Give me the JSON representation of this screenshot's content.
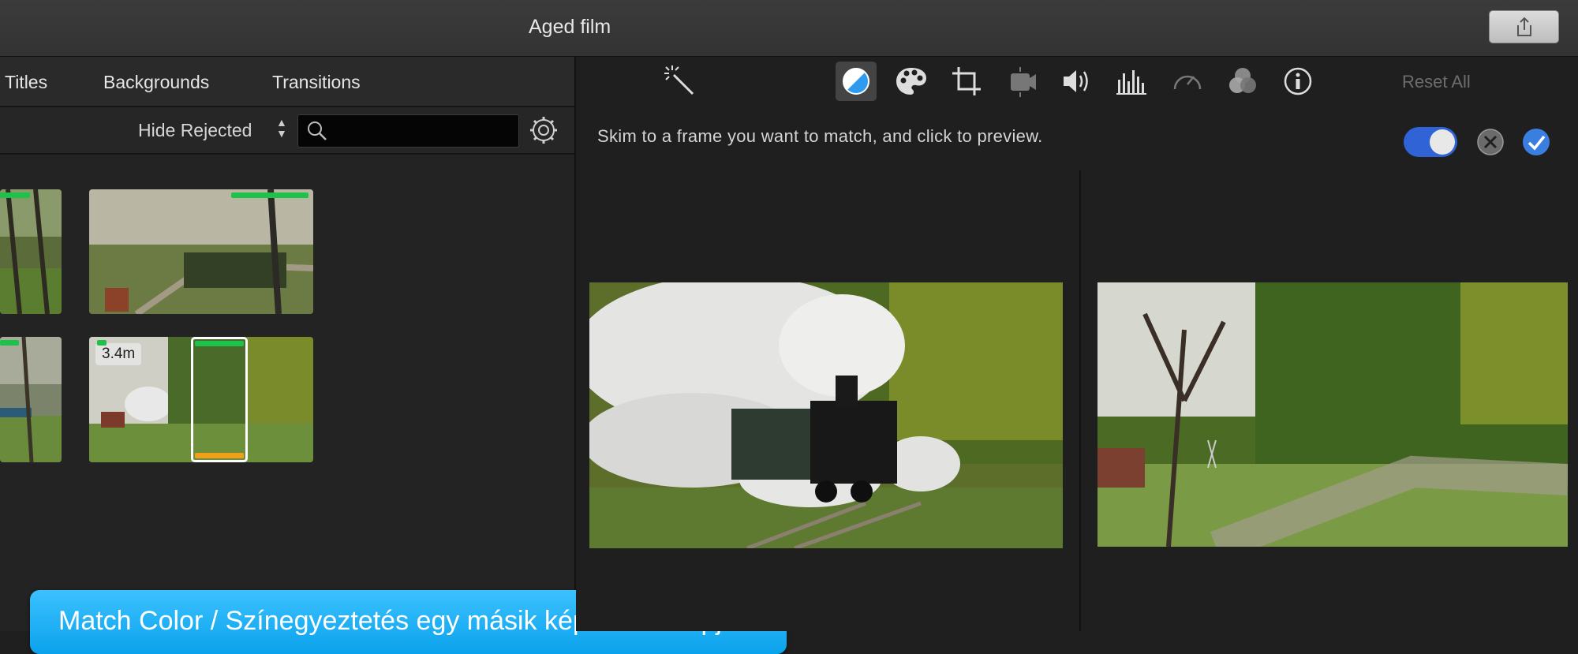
{
  "window": {
    "title": "Aged film"
  },
  "browser": {
    "tabs": [
      {
        "label": "Titles"
      },
      {
        "label": "Backgrounds"
      },
      {
        "label": "Transitions"
      }
    ],
    "filter_label": "Hide Rejected",
    "search": {
      "value": "",
      "placeholder": ""
    },
    "clips": [
      {
        "badge": ""
      },
      {
        "badge": ""
      },
      {
        "badge": ""
      },
      {
        "badge": "3.4m"
      }
    ]
  },
  "adjust": {
    "tool_icons": [
      "magic-wand-icon",
      "color-balance-icon",
      "color-palette-icon",
      "crop-icon",
      "stabilization-camera-icon",
      "volume-icon",
      "equalizer-icon",
      "speed-icon",
      "clip-filter-icon",
      "info-icon"
    ],
    "reset_label": "Reset All",
    "hint": "Skim to a frame you want to match, and click to preview.",
    "toggle_on": true,
    "accent_color": "#2f63d6",
    "confirm_color": "#3a7fe0"
  },
  "callout": {
    "text": "Match Color / Színegyeztetés egy másik képkocka alapján",
    "color": "#17aef5"
  }
}
